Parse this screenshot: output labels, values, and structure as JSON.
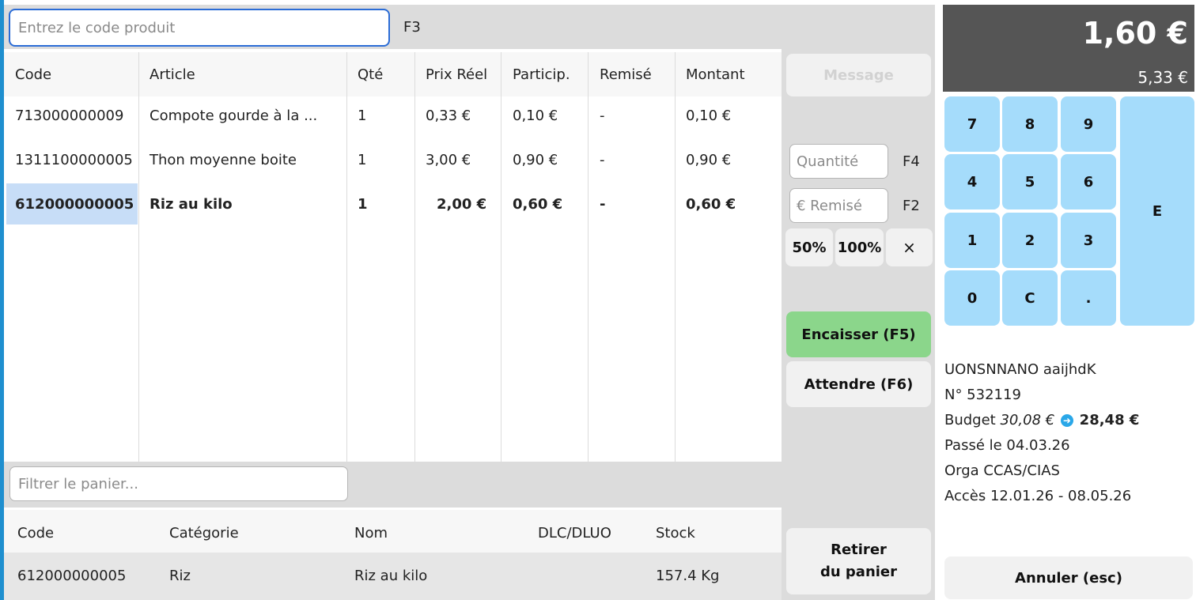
{
  "search": {
    "placeholder": "Entrez le code produit",
    "shortcut": "F3"
  },
  "cart": {
    "columns": [
      "Code",
      "Article",
      "Qté",
      "Prix Réel",
      "Particip.",
      "Remisé",
      "Montant"
    ],
    "rows": [
      [
        "713000000009",
        "Compote gourde à la ...",
        "1",
        "0,33 €",
        "0,10 €",
        "-",
        "0,10 €"
      ],
      [
        "1311100000005",
        "Thon moyenne boite",
        "1",
        "3,00 €",
        "0,90 €",
        "-",
        "0,90 €"
      ],
      [
        "612000000005",
        "Riz au kilo",
        "1",
        "2,00 €",
        "0,60 €",
        "-",
        "0,60 €"
      ]
    ],
    "filter_placeholder": "Filtrer le panier..."
  },
  "stock": {
    "columns": [
      "Code",
      "Catégorie",
      "Nom",
      "DLC/DLUO",
      "Stock"
    ],
    "row": [
      "612000000005",
      "Riz",
      "Riz au kilo",
      "",
      "157.4 Kg"
    ]
  },
  "actions": {
    "message": "Message",
    "quantity_placeholder": "Quantité",
    "quantity_key": "F4",
    "discount_placeholder": "€ Remisé",
    "discount_key": "F2",
    "pct50": "50%",
    "pct100": "100%",
    "clear": "×",
    "encaisser": "Encaisser  (F5)",
    "attendre": "Attendre  (F6)",
    "retirer_line1": "Retirer",
    "retirer_line2": "du panier",
    "annuler": "Annuler   (esc)"
  },
  "totals": {
    "main": "1,60 €",
    "sub": "5,33 €"
  },
  "keypad": [
    "7",
    "8",
    "9",
    "4",
    "5",
    "6",
    "1",
    "2",
    "3",
    "0",
    "C",
    ".",
    "E"
  ],
  "client": {
    "name": "UONSNNANO aaijhdK",
    "number": "N° 532119",
    "budget_label": "Budget",
    "budget_before": "30,08 €",
    "budget_after": "28,48 €",
    "passed": "Passé le  04.03.26",
    "orga": "Orga  CCAS/CIAS",
    "access": "Accès  12.01.26 - 08.05.26"
  },
  "colors": {
    "accent": "#2b6cd6",
    "keypad": "#a5dcfb",
    "encaisser": "#8bd68b",
    "total_bg": "#555555",
    "selection": "#c7ddf7"
  }
}
